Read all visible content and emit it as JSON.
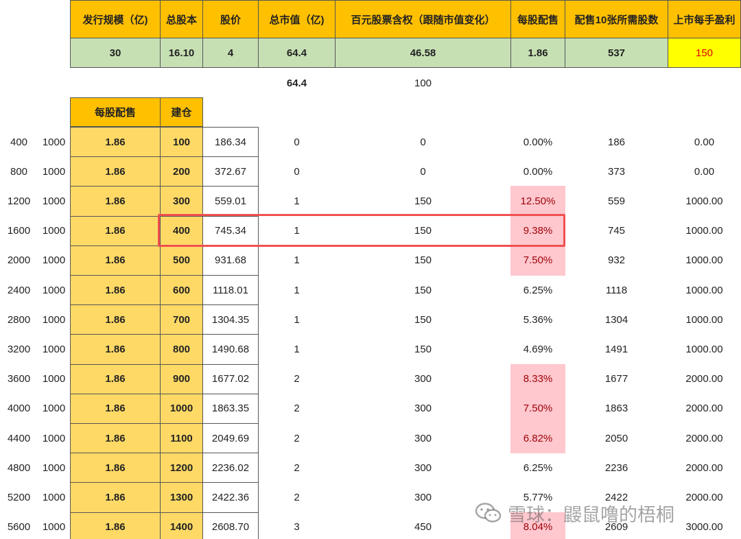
{
  "header": {
    "labels": [
      "发行规模（亿)",
      "总股本",
      "股价",
      "总市值（亿)",
      "百元股票含权（跟随市值变化）",
      "每股配售",
      "配售10张所需股数",
      "上市每手盈利"
    ],
    "values": [
      "30",
      "16.10",
      "4",
      "64.4",
      "46.58",
      "1.86",
      "537",
      "150"
    ]
  },
  "extra_row": {
    "market_cap": "64.4",
    "hundred": "100"
  },
  "sub_header": {
    "allot": "每股配售",
    "build": "建仓"
  },
  "rows": [
    [
      "400",
      "1000",
      "1.86",
      "100",
      "186.34",
      "0",
      "0",
      "0.00%",
      "186",
      "0.00"
    ],
    [
      "800",
      "1000",
      "1.86",
      "200",
      "372.67",
      "0",
      "0",
      "0.00%",
      "373",
      "0.00"
    ],
    [
      "1200",
      "1000",
      "1.86",
      "300",
      "559.01",
      "1",
      "150",
      "12.50%",
      "559",
      "1000.00"
    ],
    [
      "1600",
      "1000",
      "1.86",
      "400",
      "745.34",
      "1",
      "150",
      "9.38%",
      "745",
      "1000.00"
    ],
    [
      "2000",
      "1000",
      "1.86",
      "500",
      "931.68",
      "1",
      "150",
      "7.50%",
      "932",
      "1000.00"
    ],
    [
      "2400",
      "1000",
      "1.86",
      "600",
      "1118.01",
      "1",
      "150",
      "6.25%",
      "1118",
      "1000.00"
    ],
    [
      "2800",
      "1000",
      "1.86",
      "700",
      "1304.35",
      "1",
      "150",
      "5.36%",
      "1304",
      "1000.00"
    ],
    [
      "3200",
      "1000",
      "1.86",
      "800",
      "1490.68",
      "1",
      "150",
      "4.69%",
      "1491",
      "1000.00"
    ],
    [
      "3600",
      "1000",
      "1.86",
      "900",
      "1677.02",
      "2",
      "300",
      "8.33%",
      "1677",
      "2000.00"
    ],
    [
      "4000",
      "1000",
      "1.86",
      "1000",
      "1863.35",
      "2",
      "300",
      "7.50%",
      "1863",
      "2000.00"
    ],
    [
      "4400",
      "1000",
      "1.86",
      "1100",
      "2049.69",
      "2",
      "300",
      "6.82%",
      "2050",
      "2000.00"
    ],
    [
      "4800",
      "1000",
      "1.86",
      "1200",
      "2236.02",
      "2",
      "300",
      "6.25%",
      "2236",
      "2000.00"
    ],
    [
      "5200",
      "1000",
      "1.86",
      "1300",
      "2422.36",
      "2",
      "300",
      "5.77%",
      "2422",
      "2000.00"
    ],
    [
      "5600",
      "1000",
      "1.86",
      "1400",
      "2608.70",
      "3",
      "450",
      "8.04%",
      "2609",
      "3000.00"
    ]
  ],
  "pink_rows": [
    2,
    3,
    4,
    8,
    9,
    10,
    13
  ],
  "highlighted_row": 3,
  "watermark": {
    "text": "雪球：鼹鼠噜的梧桐"
  },
  "colors": {
    "header_fill": "#ffc000",
    "value_fill": "#c6e0b4",
    "profit_fill": "#ffff00",
    "profit_text": "#e00000",
    "allot_fill": "#ffd966",
    "pink_fill": "#ffc7ce",
    "highlight_border": "#f05050"
  }
}
